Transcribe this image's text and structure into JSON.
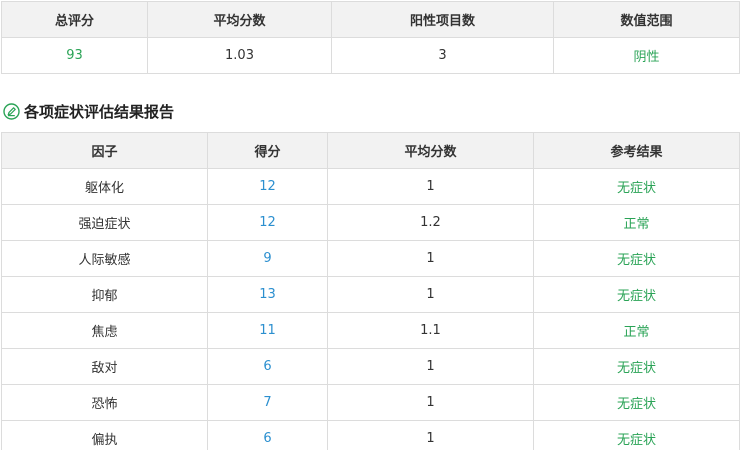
{
  "summary": {
    "headers": [
      "总评分",
      "平均分数",
      "阳性项目数",
      "数值范围"
    ],
    "total_score": "93",
    "average_score": "1.03",
    "positive_count": "3",
    "value_range": "阴性"
  },
  "section": {
    "title": "各项症状评估结果报告",
    "icon": "pencil-circle-icon"
  },
  "factors": {
    "headers": [
      "因子",
      "得分",
      "平均分数",
      "参考结果"
    ],
    "rows": [
      {
        "factor": "躯体化",
        "score": "12",
        "average": "1",
        "result": "无症状"
      },
      {
        "factor": "强迫症状",
        "score": "12",
        "average": "1.2",
        "result": "正常"
      },
      {
        "factor": "人际敏感",
        "score": "9",
        "average": "1",
        "result": "无症状"
      },
      {
        "factor": "抑郁",
        "score": "13",
        "average": "1",
        "result": "无症状"
      },
      {
        "factor": "焦虑",
        "score": "11",
        "average": "1.1",
        "result": "正常"
      },
      {
        "factor": "敌对",
        "score": "6",
        "average": "1",
        "result": "无症状"
      },
      {
        "factor": "恐怖",
        "score": "7",
        "average": "1",
        "result": "无症状"
      },
      {
        "factor": "偏执",
        "score": "6",
        "average": "1",
        "result": "无症状"
      }
    ]
  },
  "colors": {
    "accent_green": "#2aa356",
    "score_blue": "#2b8fcf",
    "header_bg": "#f2f2f2",
    "border": "#dcdcdc"
  }
}
